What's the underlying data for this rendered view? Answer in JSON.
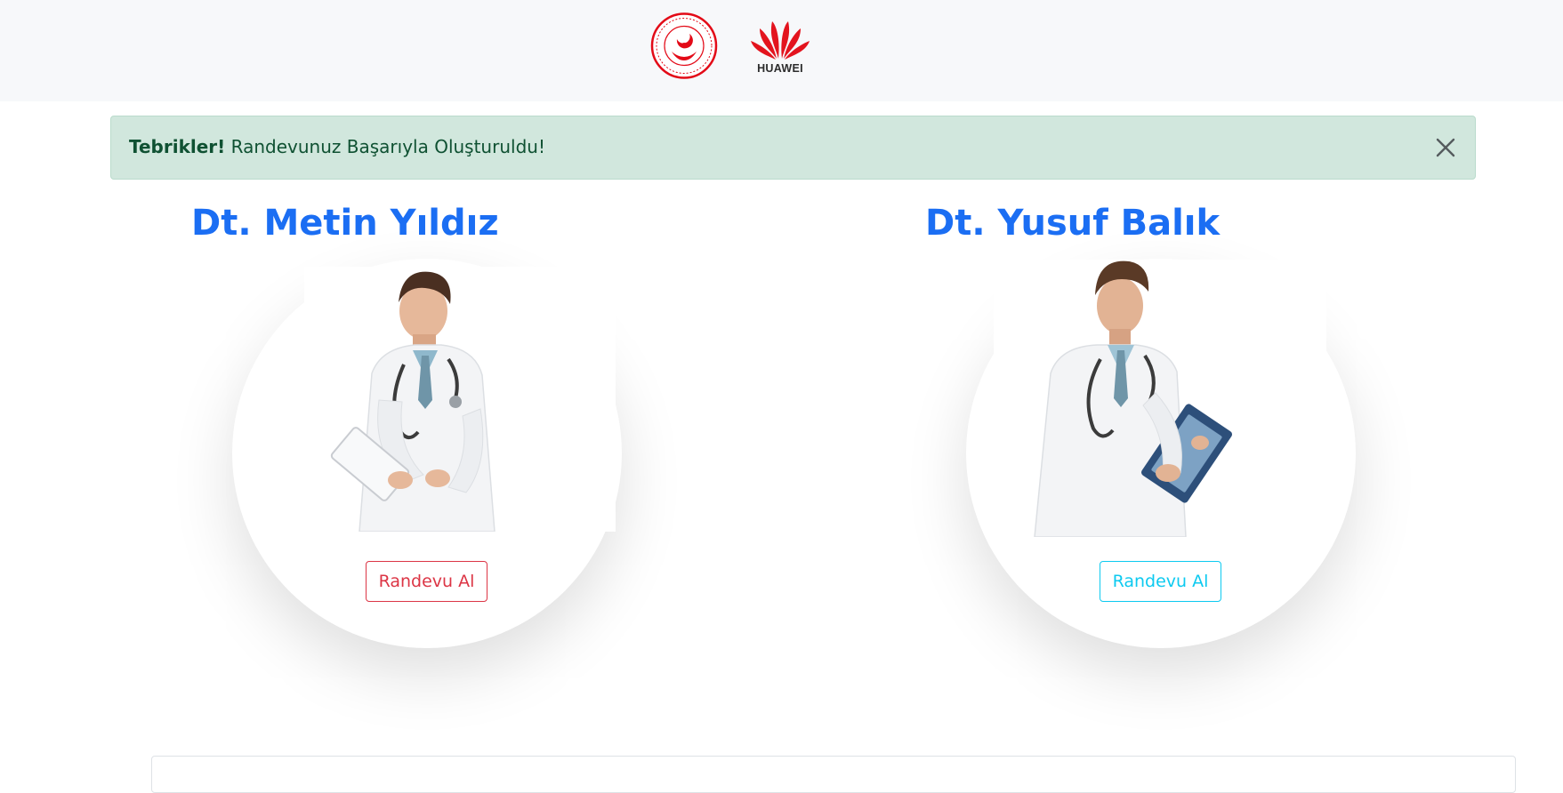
{
  "header": {
    "logos": [
      {
        "name": "ministry-emblem",
        "caption": ""
      },
      {
        "name": "huawei-logo",
        "wordmark": "HUAWEI"
      }
    ]
  },
  "alert": {
    "type": "success",
    "strong": "Tebrikler!",
    "message": " Randevunuz Başarıyla Oluşturuldu!",
    "close_icon": "close-icon"
  },
  "doctors": [
    {
      "name": "Dt. Metin Yıldız",
      "button_label": "Randevu Al",
      "button_color": "#dc3545"
    },
    {
      "name": "Dt. Yusuf Balık",
      "button_label": "Randevu Al",
      "button_color": "#0dcaf0"
    }
  ],
  "colors": {
    "accent": "#1b6ef3",
    "alert_bg": "#d1e7dd",
    "alert_text": "#0f5132"
  }
}
